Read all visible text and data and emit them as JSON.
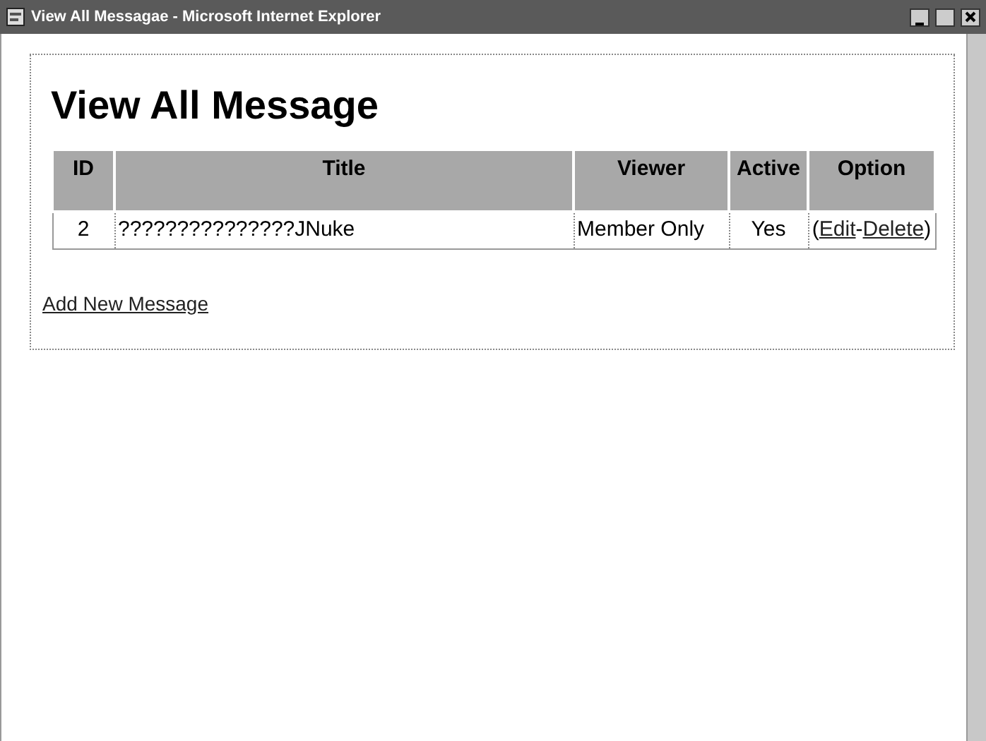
{
  "window": {
    "title": "View All Messagae - Microsoft Internet Explorer"
  },
  "heading": "View All Message",
  "table": {
    "columns": [
      "ID",
      "Title",
      "Viewer",
      "Active",
      "Option"
    ],
    "rows": [
      {
        "id": "2",
        "title": "???????????????JNuke",
        "viewer": "Member Only",
        "active": "Yes",
        "option": [
          {
            "kind": "text",
            "text": "("
          },
          {
            "kind": "link",
            "text": "Edit"
          },
          {
            "kind": "text",
            "text": "-"
          },
          {
            "kind": "link",
            "text": "Delete"
          },
          {
            "kind": "text",
            "text": ")"
          }
        ]
      }
    ]
  },
  "add_link": "Add New Message"
}
